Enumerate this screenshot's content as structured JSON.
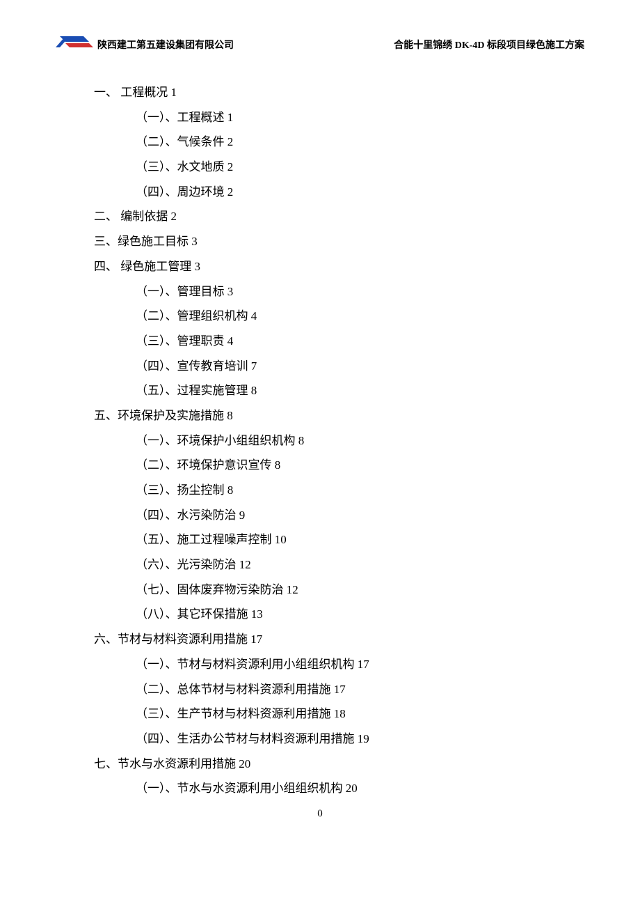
{
  "header": {
    "company": "陕西建工第五建设集团有限公司",
    "project": "合能十里锦绣 DK-4D 标段项目绿色施工方案"
  },
  "toc": [
    {
      "level": 1,
      "text": "一、 工程概况 1"
    },
    {
      "level": 2,
      "text": "（一）、工程概述 1"
    },
    {
      "level": 2,
      "text": "（二）、气候条件 2"
    },
    {
      "level": 2,
      "text": "（三）、水文地质 2"
    },
    {
      "level": 2,
      "text": "（四）、周边环境 2"
    },
    {
      "level": 1,
      "text": "二、 编制依据 2"
    },
    {
      "level": 1,
      "text": "三、绿色施工目标 3"
    },
    {
      "level": 1,
      "text": "四、 绿色施工管理 3"
    },
    {
      "level": 2,
      "text": "（一）、管理目标 3"
    },
    {
      "level": 2,
      "text": "（二）、管理组织机构 4"
    },
    {
      "level": 2,
      "text": "（三）、管理职责 4"
    },
    {
      "level": 2,
      "text": "（四）、宣传教育培训 7"
    },
    {
      "level": 2,
      "text": "（五）、过程实施管理 8"
    },
    {
      "level": 1,
      "text": "五、环境保护及实施措施 8"
    },
    {
      "level": 2,
      "text": "（一）、环境保护小组组织机构 8"
    },
    {
      "level": 2,
      "text": "（二）、环境保护意识宣传 8"
    },
    {
      "level": 2,
      "text": "（三）、扬尘控制 8"
    },
    {
      "level": 2,
      "text": "（四）、水污染防治 9"
    },
    {
      "level": 2,
      "text": "（五）、施工过程噪声控制 10"
    },
    {
      "level": 2,
      "text": "（六）、光污染防治 12"
    },
    {
      "level": 2,
      "text": "（七）、固体废弃物污染防治 12"
    },
    {
      "level": 2,
      "text": "（八）、其它环保措施 13"
    },
    {
      "level": 1,
      "text": "六、节材与材料资源利用措施 17"
    },
    {
      "level": 2,
      "text": "（一）、节材与材料资源利用小组组织机构 17"
    },
    {
      "level": 2,
      "text": "（二）、总体节材与材料资源利用措施 17"
    },
    {
      "level": 2,
      "text": "（三）、生产节材与材料资源利用措施 18"
    },
    {
      "level": 2,
      "text": "（四）、生活办公节材与材料资源利用措施 19"
    },
    {
      "level": 1,
      "text": "七、节水与水资源利用措施 20"
    },
    {
      "level": 2,
      "text": "（一）、节水与水资源利用小组组织机构 20"
    }
  ],
  "footer": {
    "page_number": "0"
  }
}
